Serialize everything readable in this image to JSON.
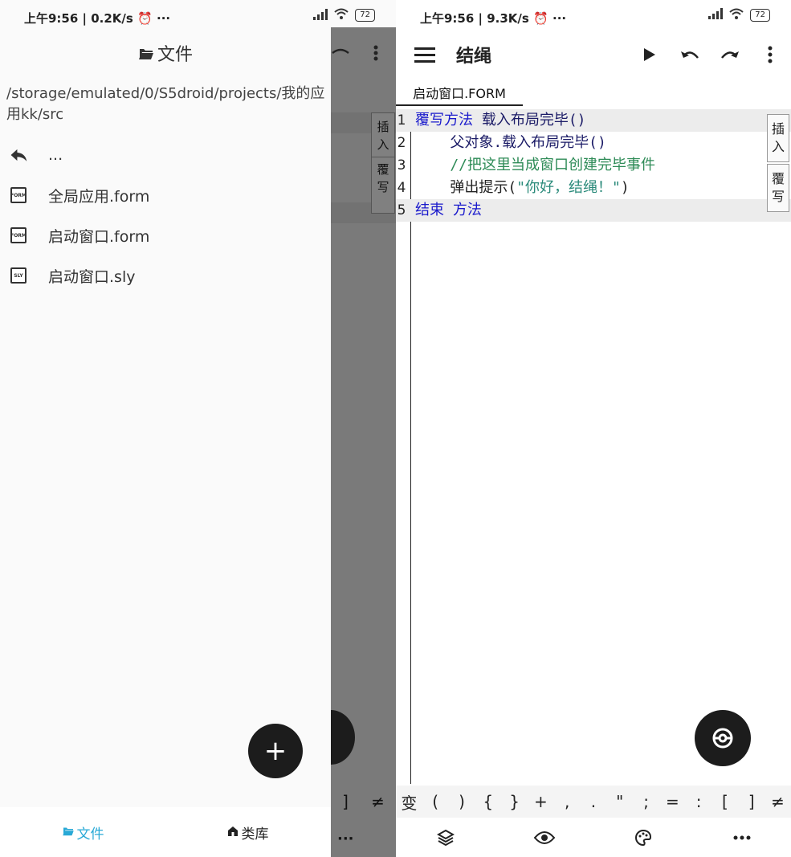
{
  "status": {
    "left_time_screen1": "上午9:56 | 0.2K/s",
    "left_time_screen2": "上午9:56 | 9.3K/s",
    "dots": "···",
    "battery": "72"
  },
  "drawer": {
    "title": "文件",
    "path": "/storage/emulated/0/S5droid/projects/我的应用kk/src",
    "items": [
      {
        "label": "...",
        "icon": "back-arrow-icon"
      },
      {
        "label": "全局应用.form",
        "icon": "form-file-icon",
        "badge": "FORM"
      },
      {
        "label": "启动窗口.form",
        "icon": "form-file-icon",
        "badge": "FORM"
      },
      {
        "label": "启动窗口.sly",
        "icon": "sly-file-icon",
        "badge": "SLY"
      }
    ],
    "fab_label": "+",
    "tabs": [
      {
        "label": "文件",
        "icon": "folder-icon"
      },
      {
        "label": "类库",
        "icon": "home-icon"
      }
    ]
  },
  "editor": {
    "app_title": "结绳",
    "tab_label": "启动窗口.FORM",
    "line_numbers": [
      "1",
      "2",
      "3",
      "4",
      "5"
    ],
    "side_buttons": [
      {
        "top": "插",
        "bottom": "入"
      },
      {
        "top": "覆",
        "bottom": "写"
      }
    ],
    "symbols": [
      "]",
      "≠",
      "变",
      "(",
      ")",
      "{",
      "}",
      "+",
      ",",
      ".",
      "\"",
      ";",
      "=",
      ":",
      "[",
      "]",
      "≠"
    ],
    "code": {
      "line1_kw": "覆写方法",
      "line1_rest": " 载入布局完毕()",
      "line2": "    父对象.载入布局完毕()",
      "line3": "    //把这里当成窗口创建完毕事件",
      "line4_a": "    弹出提示(",
      "line4_str": "\"你好，结绳！\"",
      "line4_b": ")",
      "line5": "结束 方法"
    }
  },
  "dim_symbols": [
    "]",
    "≠"
  ],
  "colors": {
    "accent": "#29a9d6",
    "keyword": "#1a1acc",
    "comment": "#2e8b57",
    "fab": "#1c1c1c"
  }
}
